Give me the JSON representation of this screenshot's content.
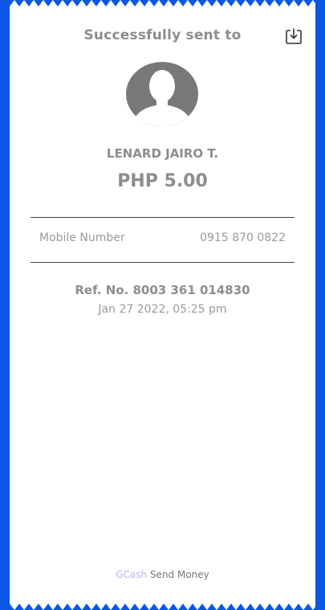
{
  "header": {
    "title": "Successfully sent to",
    "download_icon": "download-icon"
  },
  "recipient": {
    "avatar_icon": "avatar-placeholder-icon",
    "name": "LENARD JAIRO T.",
    "amount": "PHP 5.00"
  },
  "details": {
    "mobile_label": "Mobile Number",
    "mobile_value": "0915 870 0822"
  },
  "transaction": {
    "ref": "Ref. No. 8003 361 014830",
    "datetime": "Jan 27 2022, 05:25 pm"
  },
  "footer": {
    "brand": "GCash",
    "caption": "Send Money"
  },
  "colors": {
    "background": "#0b57e3",
    "receipt": "#ffffff",
    "text_muted": "#8d8d8d",
    "brand": "#b3b7e8"
  }
}
